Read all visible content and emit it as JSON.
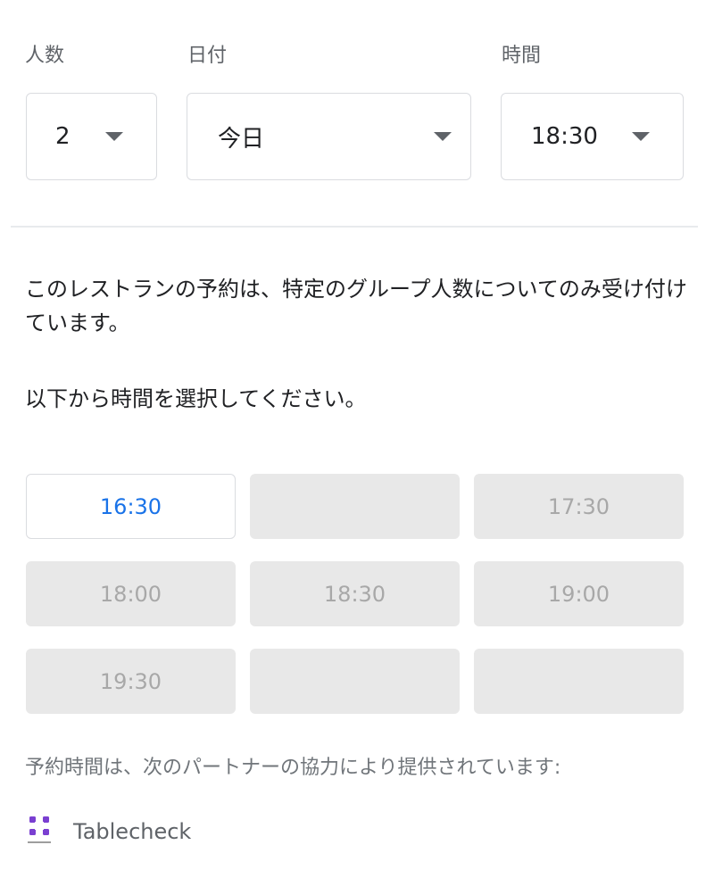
{
  "labels": {
    "party_size": "人数",
    "date": "日付",
    "time": "時間"
  },
  "selects": {
    "party_size": "2",
    "date": "今日",
    "time": "18:30"
  },
  "notice": "このレストランの予約は、特定のグループ人数についてのみ受け付けています。",
  "instruction": "以下から時間を選択してください。",
  "slots": [
    {
      "label": "16:30",
      "state": "available"
    },
    {
      "label": "",
      "state": "disabled"
    },
    {
      "label": "17:30",
      "state": "disabled"
    },
    {
      "label": "18:00",
      "state": "disabled"
    },
    {
      "label": "18:30",
      "state": "disabled"
    },
    {
      "label": "19:00",
      "state": "disabled"
    },
    {
      "label": "19:30",
      "state": "disabled"
    },
    {
      "label": "",
      "state": "disabled"
    },
    {
      "label": "",
      "state": "disabled"
    }
  ],
  "partner": {
    "text": "予約時間は、次のパートナーの協力により提供されています:",
    "name": "Tablecheck",
    "logo_icon": "tablecheck-logo-icon",
    "logo_color": "#7a3fd1"
  },
  "colors": {
    "accent": "#1a73e8",
    "disabled_bg": "#e8e8e8",
    "disabled_text": "#a8a8a8"
  }
}
